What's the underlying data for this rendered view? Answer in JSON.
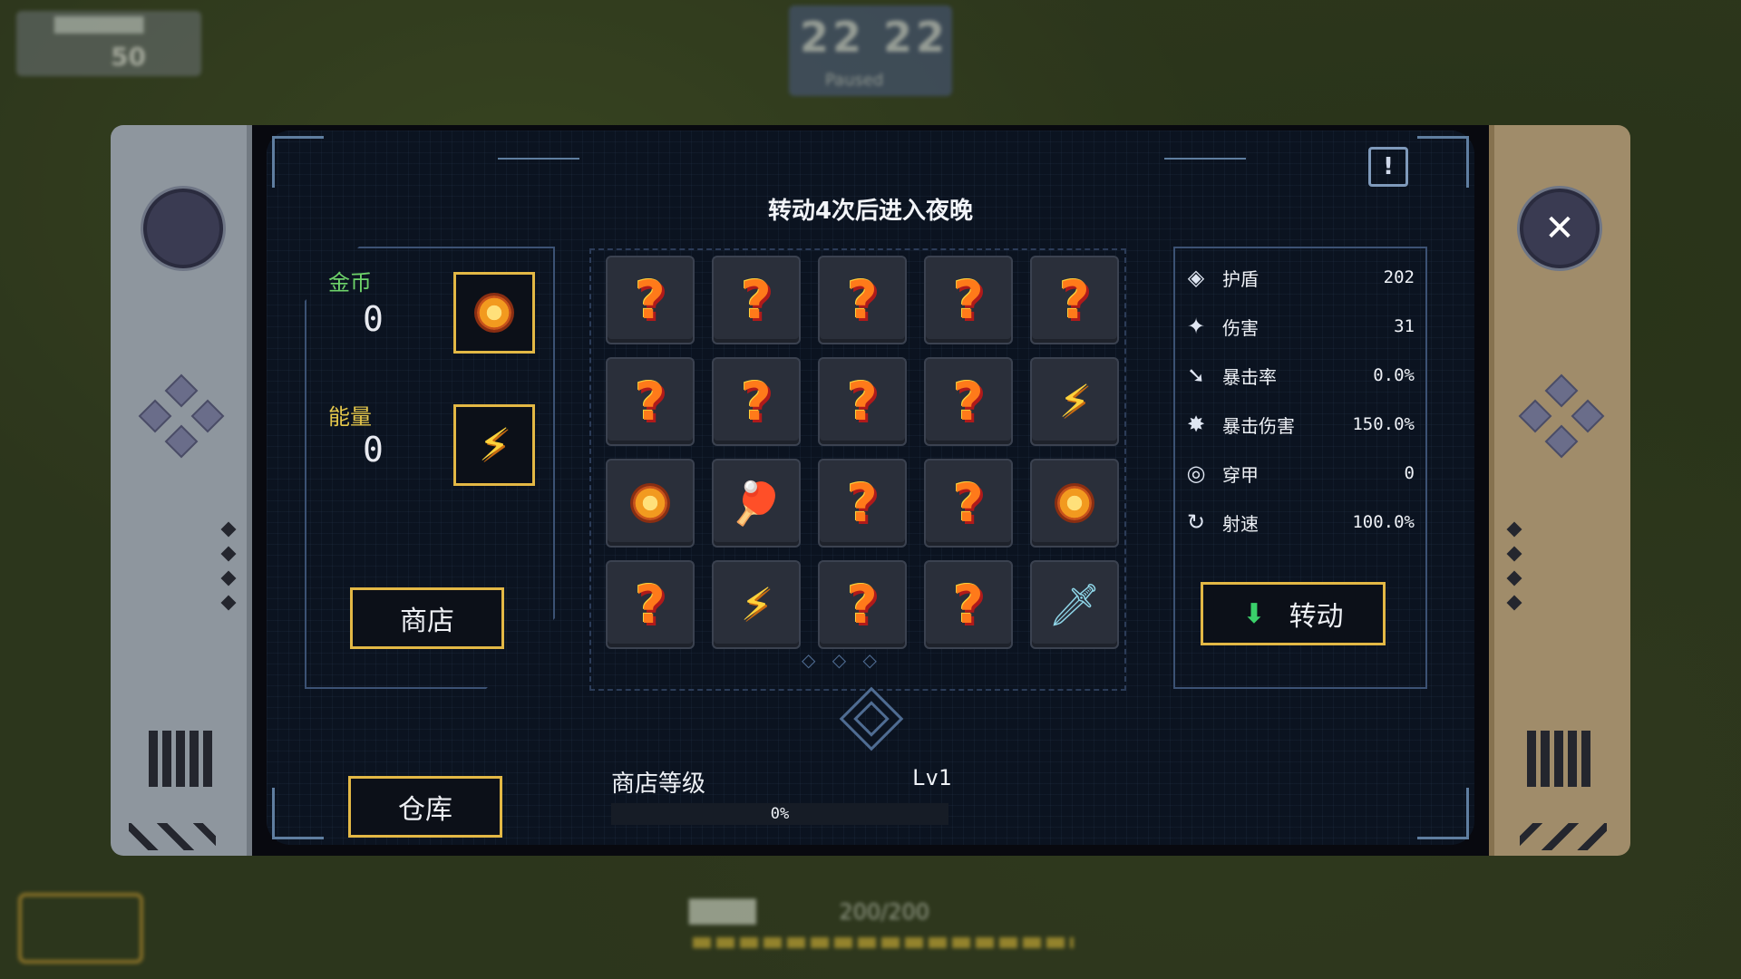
{
  "hud": {
    "top_left_title": "████████",
    "top_left_value": "50",
    "timer": "22 22",
    "timer_sub": "Paused",
    "bottom_label": "████",
    "bottom_value": "200/200"
  },
  "panel": {
    "title": "转动4次后进入夜晚",
    "info_icon": "!",
    "close_icon": "✕"
  },
  "resources": {
    "coin_label": "金币",
    "coin_value": "0",
    "energy_label": "能量",
    "energy_value": "0"
  },
  "buttons": {
    "shop": "商店",
    "storage": "仓库",
    "spin": "转动"
  },
  "grid": {
    "cells": [
      "question",
      "question",
      "question",
      "question",
      "question",
      "question",
      "question",
      "question",
      "question",
      "energy",
      "coin",
      "paddle",
      "question",
      "question",
      "coin",
      "question",
      "energy",
      "question",
      "question",
      "knife"
    ]
  },
  "stats": [
    {
      "icon": "shield-icon",
      "glyph": "◈",
      "name": "护盾",
      "value": "202"
    },
    {
      "icon": "damage-icon",
      "glyph": "✦",
      "name": "伤害",
      "value": "31"
    },
    {
      "icon": "crit-rate-icon",
      "glyph": "➘",
      "name": "暴击率",
      "value": "0.0%"
    },
    {
      "icon": "crit-damage-icon",
      "glyph": "✸",
      "name": "暴击伤害",
      "value": "150.0%"
    },
    {
      "icon": "penetration-icon",
      "glyph": "◎",
      "name": "穿甲",
      "value": "0"
    },
    {
      "icon": "fire-rate-icon",
      "glyph": "↻",
      "name": "射速",
      "value": "100.0%"
    }
  ],
  "shop_level": {
    "label": "商店等级",
    "level": "Lv1",
    "progress_text": "0%",
    "progress": 0
  },
  "colors": {
    "coin_label": "#6ed36a",
    "energy_label": "#e4c64a",
    "gold_border": "#e3b845",
    "frame": "#5f7ea0"
  }
}
